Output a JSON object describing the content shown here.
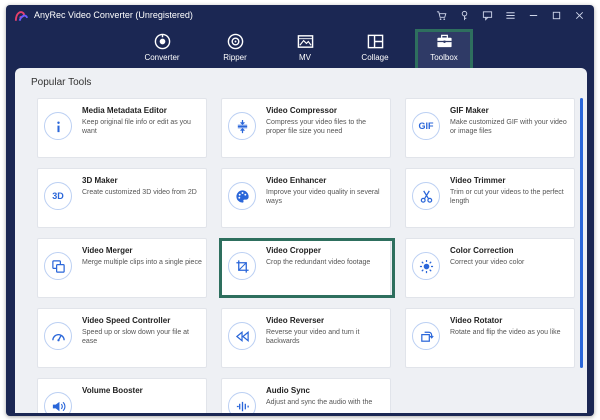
{
  "window": {
    "title": "AnyRec Video Converter (Unregistered)"
  },
  "tabs": [
    {
      "label": "Converter",
      "icon": "converter-icon"
    },
    {
      "label": "Ripper",
      "icon": "ripper-icon"
    },
    {
      "label": "MV",
      "icon": "mv-icon"
    },
    {
      "label": "Collage",
      "icon": "collage-icon"
    },
    {
      "label": "Toolbox",
      "icon": "toolbox-icon",
      "active": true
    }
  ],
  "section": {
    "title": "Popular Tools"
  },
  "tools": [
    {
      "name": "Media Metadata Editor",
      "desc": "Keep original file info or edit as you want",
      "icon": "info-icon"
    },
    {
      "name": "Video Compressor",
      "desc": "Compress your video files to the proper file size you need",
      "icon": "compress-icon"
    },
    {
      "name": "GIF Maker",
      "desc": "Make customized GIF with your video or image files",
      "icon": "gif-icon",
      "glyph": "GIF"
    },
    {
      "name": "3D Maker",
      "desc": "Create customized 3D video from 2D",
      "icon": "3d-icon",
      "glyph": "3D"
    },
    {
      "name": "Video Enhancer",
      "desc": "Improve your video quality in several ways",
      "icon": "palette-icon"
    },
    {
      "name": "Video Trimmer",
      "desc": "Trim or cut your videos to the perfect length",
      "icon": "scissors-icon"
    },
    {
      "name": "Video Merger",
      "desc": "Merge multiple clips into a single piece",
      "icon": "merge-icon"
    },
    {
      "name": "Video Cropper",
      "desc": "Crop the redundant video footage",
      "icon": "crop-icon"
    },
    {
      "name": "Color Correction",
      "desc": "Correct your video color",
      "icon": "sun-icon"
    },
    {
      "name": "Video Speed Controller",
      "desc": "Speed up or slow down your file at ease",
      "icon": "speedometer-icon"
    },
    {
      "name": "Video Reverser",
      "desc": "Reverse your video and turn it backwards",
      "icon": "rewind-icon"
    },
    {
      "name": "Video Rotator",
      "desc": "Rotate and flip the video as you like",
      "icon": "rotate-icon"
    },
    {
      "name": "Volume Booster",
      "desc": "",
      "icon": "volume-icon"
    },
    {
      "name": "Audio Sync",
      "desc": "Adjust and sync the audio with the",
      "icon": "audio-sync-icon"
    }
  ],
  "colors": {
    "frame": "#1b2753",
    "accent": "#2a66d9",
    "highlight": "#2e6f5e",
    "content_bg": "#eef0f4"
  }
}
